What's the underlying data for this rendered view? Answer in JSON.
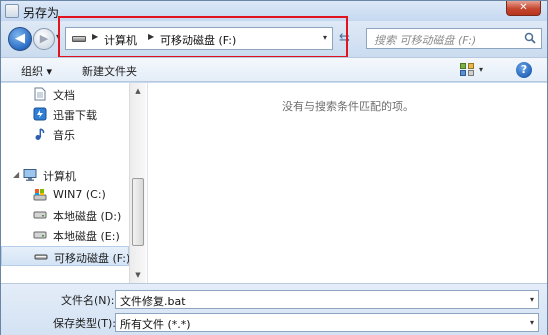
{
  "window": {
    "title": "另存为",
    "close_symbol": "✕"
  },
  "nav": {
    "back_symbol": "◀",
    "forward_symbol": "▶",
    "recent_symbol": "▾",
    "refresh_symbol": "⇆",
    "address": {
      "crumbs": [
        "计算机",
        "可移动磁盘 (F:)"
      ],
      "separator": "▶",
      "dropdown_symbol": "▾"
    },
    "search": {
      "placeholder": "搜索 可移动磁盘 (F:)"
    }
  },
  "toolbar": {
    "organize_label": "组织 ▾",
    "new_folder_label": "新建文件夹",
    "view_arrow": "▾",
    "help_symbol": "?"
  },
  "sidebar": {
    "items": [
      {
        "label": "文档",
        "icon": "document-icon"
      },
      {
        "label": "迅雷下载",
        "icon": "thunder-download-icon"
      },
      {
        "label": "音乐",
        "icon": "music-icon"
      },
      {
        "label": "计算机",
        "icon": "computer-icon"
      },
      {
        "label": "WIN7 (C:)",
        "icon": "system-drive-icon"
      },
      {
        "label": "本地磁盘 (D:)",
        "icon": "hard-drive-icon"
      },
      {
        "label": "本地磁盘 (E:)",
        "icon": "hard-drive-icon"
      },
      {
        "label": "可移动磁盘 (F:)",
        "icon": "removable-drive-icon"
      }
    ],
    "selected_index": 7
  },
  "content": {
    "empty_message": "没有与搜索条件匹配的项。"
  },
  "form": {
    "filename_label": "文件名(N):",
    "filename_value": "文件修复.bat",
    "filetype_label": "保存类型(T):",
    "filetype_value": "所有文件 (*.*)",
    "dropdown_symbol": "▾"
  },
  "colors": {
    "highlight_border": "#e0131e",
    "accent": "#2a6cc5"
  }
}
